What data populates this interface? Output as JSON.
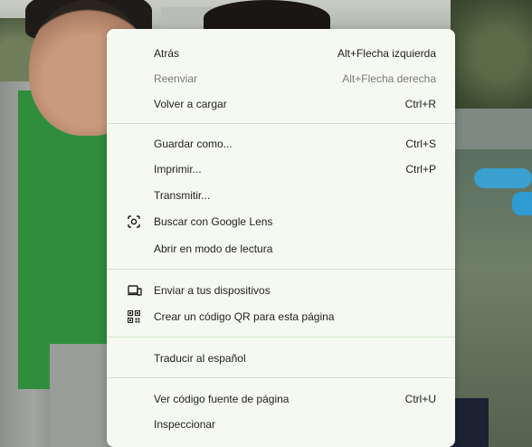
{
  "menu": {
    "items": [
      {
        "label": "Atrás",
        "shortcut": "Alt+Flecha izquierda"
      },
      {
        "label": "Reenviar",
        "shortcut": "Alt+Flecha derecha",
        "disabled": true
      },
      {
        "label": "Volver a cargar",
        "shortcut": "Ctrl+R"
      },
      {
        "label": "Guardar como...",
        "shortcut": "Ctrl+S"
      },
      {
        "label": "Imprimir...",
        "shortcut": "Ctrl+P"
      },
      {
        "label": "Transmitir..."
      },
      {
        "label": "Buscar con Google Lens",
        "icon": "lens-icon"
      },
      {
        "label": "Abrir en modo de lectura"
      },
      {
        "label": "Enviar a tus dispositivos",
        "icon": "devices-icon"
      },
      {
        "label": "Crear un código QR para esta página",
        "icon": "qr-code-icon"
      },
      {
        "label": "Traducir al español"
      },
      {
        "label": "Ver código fuente de página",
        "shortcut": "Ctrl+U"
      },
      {
        "label": "Inspeccionar"
      }
    ]
  },
  "colors": {
    "menu_background": "#f6f9f2",
    "separator": "#cfe4c8",
    "text": "#1f1f1f",
    "disabled_text": "#7a7a7a"
  }
}
